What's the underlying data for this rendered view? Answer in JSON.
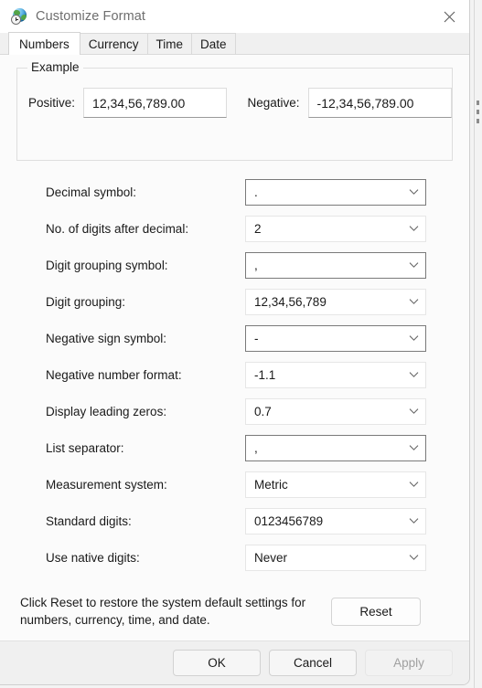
{
  "window": {
    "title": "Customize Format",
    "icon": "region-globe-clock-icon",
    "close_label": "✕"
  },
  "tabs": [
    {
      "label": "Numbers",
      "selected": true
    },
    {
      "label": "Currency",
      "selected": false
    },
    {
      "label": "Time",
      "selected": false
    },
    {
      "label": "Date",
      "selected": false
    }
  ],
  "example": {
    "legend": "Example",
    "positive_label": "Positive:",
    "positive_value": "12,34,56,789.00",
    "negative_label": "Negative:",
    "negative_value": "-12,34,56,789.00"
  },
  "settings": [
    {
      "label": "Decimal symbol:",
      "value": ".",
      "editable": true
    },
    {
      "label": "No. of digits after decimal:",
      "value": "2",
      "editable": false
    },
    {
      "label": "Digit grouping symbol:",
      "value": ",",
      "editable": true
    },
    {
      "label": "Digit grouping:",
      "value": "12,34,56,789",
      "editable": false
    },
    {
      "label": "Negative sign symbol:",
      "value": "-",
      "editable": true
    },
    {
      "label": "Negative number format:",
      "value": "-1.1",
      "editable": false
    },
    {
      "label": "Display leading zeros:",
      "value": "0.7",
      "editable": false
    },
    {
      "label": "List separator:",
      "value": ",",
      "editable": true
    },
    {
      "label": "Measurement system:",
      "value": "Metric",
      "editable": false
    },
    {
      "label": "Standard digits:",
      "value": "0123456789",
      "editable": false
    },
    {
      "label": "Use native digits:",
      "value": "Never",
      "editable": false
    }
  ],
  "reset": {
    "description": "Click Reset to restore the system default settings for numbers, currency, time, and date.",
    "button_label": "Reset"
  },
  "footer": {
    "ok_label": "OK",
    "cancel_label": "Cancel",
    "apply_label": "Apply",
    "apply_enabled": false
  },
  "colors": {
    "dialog_background": "#fbfbfb",
    "title_background": "#ffffff",
    "tabstrip_background": "#f0f0f0",
    "footer_background": "#f0f0f0",
    "text": "#1a1a1a",
    "title_text": "#6e6e6e",
    "disabled_text": "#a0a0a0",
    "editable_border": "#7a7a7a",
    "readonly_border": "#e6e6e6"
  }
}
